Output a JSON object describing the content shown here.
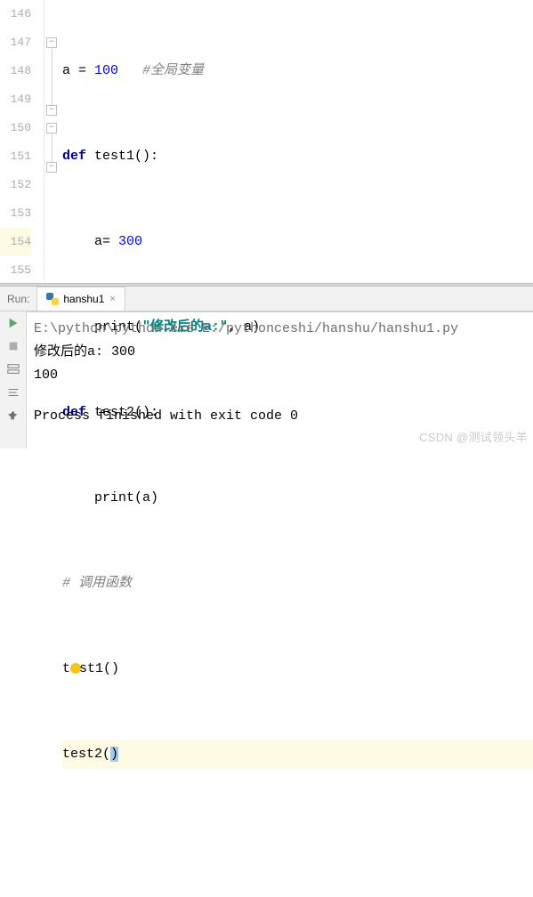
{
  "gutter": [
    "146",
    "147",
    "148",
    "149",
    "150",
    "151",
    "152",
    "153",
    "154",
    "155"
  ],
  "code": {
    "l146": {
      "pre": "a = ",
      "num": "100",
      "gap": "   ",
      "comment": "#全局变量"
    },
    "l147": {
      "kw": "def",
      "sp": " ",
      "fn": "test1",
      "par": "():"
    },
    "l148": {
      "indent": "    ",
      "txt": "a= ",
      "num": "300"
    },
    "l149": {
      "indent": "    ",
      "fn": "print",
      "open": "(",
      "str": "\"修改后的a:\"",
      "rest": ", a)"
    },
    "l150": {
      "kw": "def",
      "sp": " ",
      "fn": "test2",
      "par": "():"
    },
    "l151": {
      "indent": "    ",
      "fn": "print",
      "par": "(a)"
    },
    "l152": {
      "comment": "# 调用函数"
    },
    "l153": {
      "pre": "t",
      "post": "st1()"
    },
    "l154": {
      "txt": "test2",
      "open": "(",
      "sel": ")"
    }
  },
  "run": {
    "label": "Run:",
    "tab": "hanshu1",
    "close": "×",
    "cmd": "E:\\python\\python.exe E:/pythonceshi/hanshu/hanshu1.py",
    "out1": "修改后的a:  300",
    "out2": "100",
    "exit": "Process finished with exit code 0"
  },
  "watermark": "CSDN @测试领头羊"
}
